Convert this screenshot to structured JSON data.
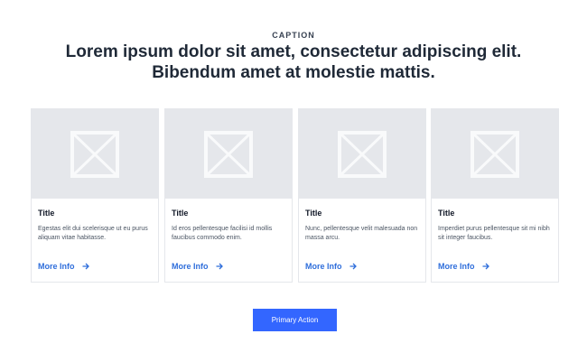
{
  "header": {
    "caption": "CAPTION",
    "headline_line1": "Lorem ipsum dolor sit amet, consectetur adipiscing elit.",
    "headline_line2": "Bibendum amet at molestie mattis."
  },
  "cards": [
    {
      "image_icon": "image-placeholder-icon",
      "title": "Title",
      "description": "Egestas elit dui scelerisque ut eu purus aliquam vitae habitasse.",
      "link_label": "More Info",
      "link_icon": "arrow-right-icon"
    },
    {
      "image_icon": "image-placeholder-icon",
      "title": "Title",
      "description": "Id eros pellentesque facilisi id mollis faucibus commodo enim.",
      "link_label": "More Info",
      "link_icon": "arrow-right-icon"
    },
    {
      "image_icon": "image-placeholder-icon",
      "title": "Title",
      "description": "Nunc, pellentesque velit malesuada non massa arcu.",
      "link_label": "More Info",
      "link_icon": "arrow-right-icon"
    },
    {
      "image_icon": "image-placeholder-icon",
      "title": "Title",
      "description": "Imperdiet purus pellentesque sit mi nibh sit integer faucibus.",
      "link_label": "More Info",
      "link_icon": "arrow-right-icon"
    }
  ],
  "primary_action": {
    "label": "Primary Action"
  },
  "colors": {
    "accent": "#3366ff",
    "link": "#2f6edb",
    "placeholder_bg": "#e5e7eb",
    "heading": "#1f2937"
  }
}
